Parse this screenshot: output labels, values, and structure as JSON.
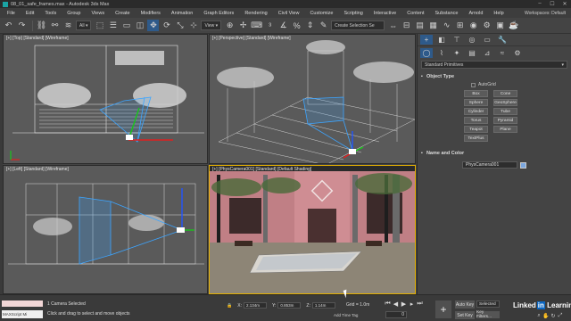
{
  "window": {
    "title": "08_01_safe_frames.max - Autodesk 3ds Max"
  },
  "menu": [
    "File",
    "Edit",
    "Tools",
    "Group",
    "Views",
    "Create",
    "Modifiers",
    "Animation",
    "Graph Editors",
    "Rendering",
    "Civil View",
    "Customize",
    "Scripting",
    "Interactive",
    "Content",
    "Substance",
    "Arnold",
    "Help"
  ],
  "workspaces_label": "Workspaces: Default",
  "toolbar": {
    "filter_value": "All",
    "view_value": "View",
    "selection_set_placeholder": "Create Selection Se"
  },
  "viewports": {
    "top": "[+] [Top] [Standard] [Wireframe]",
    "perspective": "[+] [Perspective] [Standard] [Wireframe]",
    "left": "[+] [Left] [Standard] [Wireframe]",
    "camera": "[+] [PhysCamera001] [Standard] [Default Shading]"
  },
  "command_panel": {
    "category": "Standard Primitives",
    "object_type_title": "Object Type",
    "autogrid_label": "AutoGrid",
    "objects": [
      "Box",
      "Cone",
      "Sphere",
      "GeoSphere",
      "Cylinder",
      "Tube",
      "Torus",
      "Pyramid",
      "Teapot",
      "Plane",
      "TextPlus"
    ],
    "name_color_title": "Name and Color",
    "name_value": "PhysCamera001",
    "swatch_color": "#7ba7e0"
  },
  "status": {
    "maxscript_label": "MAXScript Mi",
    "selection": "1 Camera Selected",
    "hint": "Click and drag to select and move objects",
    "x_label": "X:",
    "x_value": "2.134m",
    "y_label": "Y:",
    "y_value": "0.853m",
    "z_label": "Z:",
    "z_value": "1.14m",
    "grid": "Grid = 1.0m",
    "add_time_tag": "Add Time Tag",
    "frame": "0",
    "auto_key": "Auto Key",
    "set_key": "Set Key",
    "selected_dd": "Selected",
    "key_filters": "Key Filters...",
    "brand": "Linked",
    "brand_in": "in",
    "brand_suffix": " Learning"
  },
  "colors": {
    "accent": "#2e5a8a",
    "active_viewport_border": "#e5b100",
    "camera_frustum": "#3da5ff"
  }
}
